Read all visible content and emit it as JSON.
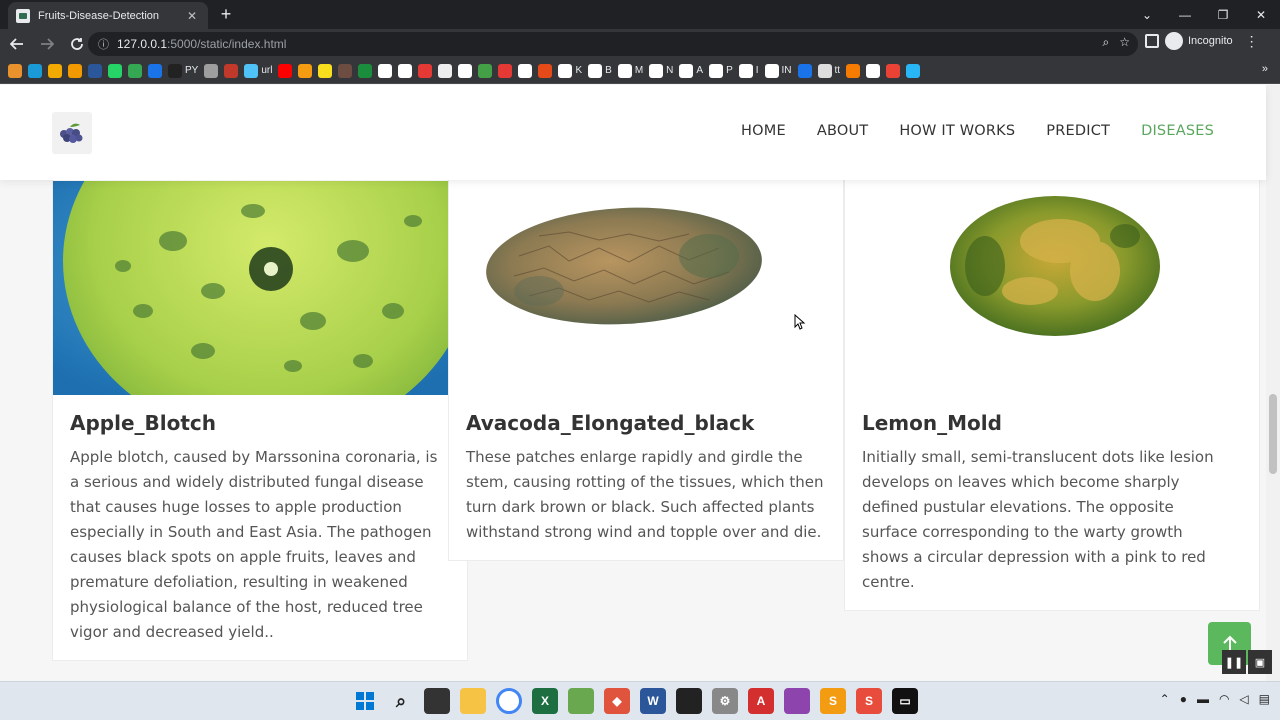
{
  "browser": {
    "tab_title": "Fruits-Disease-Detection",
    "tab_close": "✕",
    "new_tab": "+",
    "url_host": "127.0.0.1",
    "url_rest": ":5000/static/index.html",
    "incognito_label": "Incognito",
    "window_controls": [
      "⌄",
      "—",
      "❐",
      "✕"
    ]
  },
  "bookmarks": [
    {
      "label": "",
      "color": "#e8912d"
    },
    {
      "label": "",
      "color": "#1a9bd7"
    },
    {
      "label": "",
      "color": "#f2a900"
    },
    {
      "label": "",
      "color": "#f29900"
    },
    {
      "label": "",
      "color": "#2b579a"
    },
    {
      "label": "",
      "color": "#25d366"
    },
    {
      "label": "",
      "color": "#34a853"
    },
    {
      "label": "",
      "color": "#1a73e8"
    },
    {
      "label": "PY",
      "color": "#222222"
    },
    {
      "label": "",
      "color": "#9e9e9e"
    },
    {
      "label": "",
      "color": "#c0392b"
    },
    {
      "label": "url",
      "color": "#4fc3f7"
    },
    {
      "label": "",
      "color": "#ff0000"
    },
    {
      "label": "",
      "color": "#f39c12"
    },
    {
      "label": "",
      "color": "#f7df1e"
    },
    {
      "label": "",
      "color": "#6d4c41"
    },
    {
      "label": "",
      "color": "#1b8e3e"
    },
    {
      "label": "",
      "color": "#ffffff"
    },
    {
      "label": "",
      "color": "#ffffff"
    },
    {
      "label": "",
      "color": "#e53935"
    },
    {
      "label": "",
      "color": "#eeeeee"
    },
    {
      "label": "",
      "color": "#ffffff"
    },
    {
      "label": "",
      "color": "#43a047"
    },
    {
      "label": "",
      "color": "#e53935"
    },
    {
      "label": "",
      "color": "#ffffff"
    },
    {
      "label": "",
      "color": "#e64a19"
    },
    {
      "label": "K",
      "color": "#ffffff"
    },
    {
      "label": "B",
      "color": "#ffffff"
    },
    {
      "label": "M",
      "color": "#ffffff"
    },
    {
      "label": "N",
      "color": "#ffffff"
    },
    {
      "label": "A",
      "color": "#ffffff"
    },
    {
      "label": "P",
      "color": "#ffffff"
    },
    {
      "label": "I",
      "color": "#ffffff"
    },
    {
      "label": "IN",
      "color": "#ffffff"
    },
    {
      "label": "",
      "color": "#1a73e8"
    },
    {
      "label": "tt",
      "color": "#dddddd"
    },
    {
      "label": "",
      "color": "#f57c00"
    },
    {
      "label": "",
      "color": "#ffffff"
    },
    {
      "label": "",
      "color": "#ea4335"
    },
    {
      "label": "",
      "color": "#29b6f6"
    }
  ],
  "site": {
    "nav": [
      "HOME",
      "ABOUT",
      "HOW IT WORKS",
      "PREDICT",
      "DISEASES"
    ],
    "active_nav": "DISEASES",
    "accent_color": "#5aa75d"
  },
  "cards": [
    {
      "title": "Apple_Blotch",
      "lines": [
        "Apple blotch, caused by Marssonina coronaria, is",
        "a serious and widely distributed fungal disease",
        "that causes huge losses to apple production",
        "especially in South and East Asia. The pathogen",
        "causes black spots on apple fruits, leaves and",
        "premature defoliation, resulting in weakened",
        "physiological balance of the host, reduced tree",
        "vigor and decreased yield.."
      ]
    },
    {
      "title": "Avacoda_Elongated_black",
      "lines": [
        "These patches enlarge rapidly and girdle the",
        "stem, causing rotting of the tissues, which then",
        "turn dark brown or black. Such affected plants",
        "withstand strong wind and topple over and die."
      ]
    },
    {
      "title": "Lemon_Mold",
      "lines": [
        "Initially small, semi-translucent dots like lesion",
        "develops on leaves which become sharply",
        "defined pustular elevations. The opposite",
        "surface corresponding to the warty growth",
        "shows a circular depression with a pink to red",
        "centre."
      ]
    }
  ],
  "to_top_icon": "arrow-up-icon"
}
